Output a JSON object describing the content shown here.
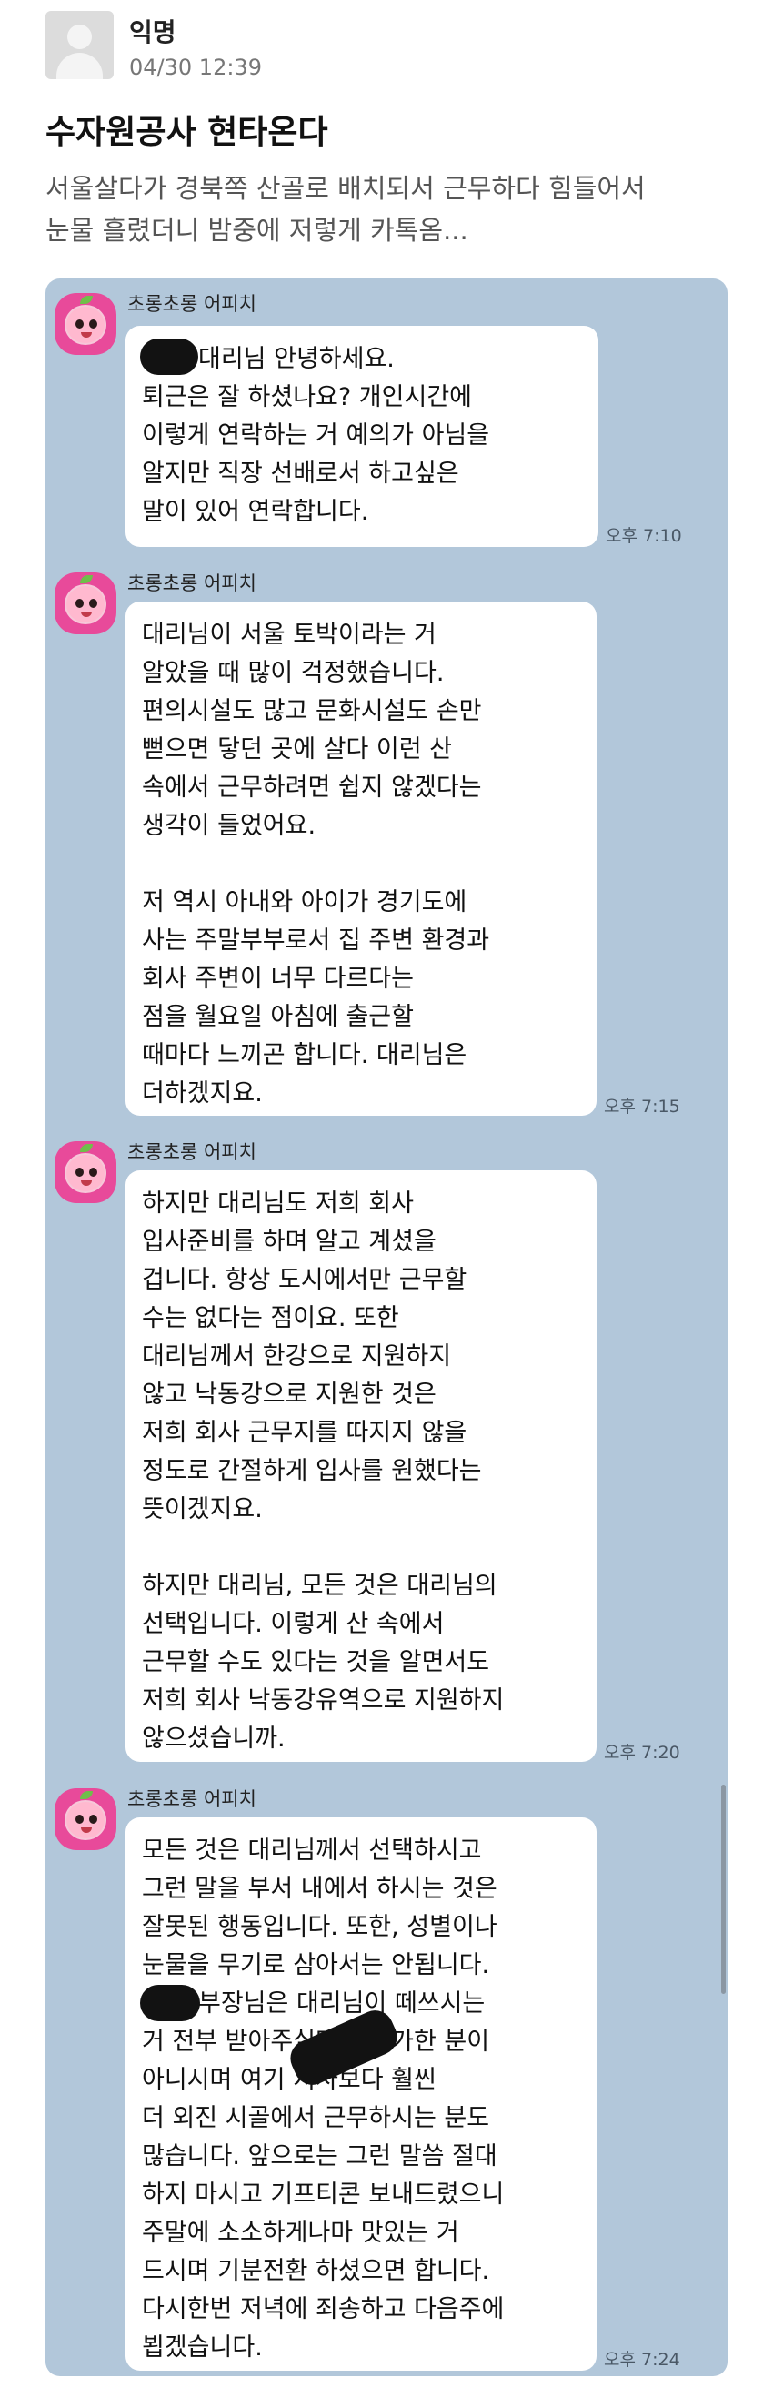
{
  "post": {
    "author": "익명",
    "date": "04/30 12:39",
    "title": "수자원공사 현타온다",
    "body_lines": [
      "서울살다가 경북쪽 산골로 배치되서 근무하다 힘들어서",
      "눈물 흘렸더니 밤중에 저렇게 카톡옴..."
    ]
  },
  "chat": {
    "sender": "초롱초롱 어피치",
    "messages": [
      {
        "lines": [
          "대리님 안녕하세요.",
          "퇴근은 잘 하셨나요? 개인시간에",
          "이렇게 연락하는 거 예의가 아님을",
          "알지만 직장 선배로서 하고싶은",
          "말이 있어 연락합니다."
        ],
        "time": "오후 7:10"
      },
      {
        "lines": [
          "대리님이 서울 토박이라는 거",
          "알았을 때 많이 걱정했습니다.",
          "편의시설도 많고 문화시설도 손만",
          "뻗으면 닿던 곳에 살다 이런 산",
          "속에서 근무하려면 쉽지 않겠다는",
          "생각이 들었어요.",
          "",
          "저 역시 아내와 아이가 경기도에",
          "사는 주말부부로서 집 주변 환경과",
          "회사 주변이 너무 다르다는",
          "점을 월요일 아침에 출근할",
          "때마다 느끼곤 합니다. 대리님은",
          "더하겠지요."
        ],
        "time": "오후 7:15"
      },
      {
        "lines": [
          "하지만 대리님도 저희 회사",
          "입사준비를 하며 알고 계셨을",
          "겁니다. 항상 도시에서만 근무할",
          "수는 없다는 점이요. 또한",
          "대리님께서 한강으로 지원하지",
          "않고 낙동강으로 지원한 것은",
          "저희 회사 근무지를 따지지 않을",
          "정도로 간절하게 입사를 원했다는",
          "뜻이겠지요.",
          "",
          "하지만 대리님, 모든 것은 대리님의",
          "선택입니다. 이렇게 산 속에서",
          "근무할 수도 있다는 것을 알면서도",
          "저희 회사 낙동강유역으로 지원하지",
          "않으셨습니까."
        ],
        "time": "오후 7:20"
      },
      {
        "lines": [
          "모든 것은 대리님께서 선택하시고",
          "그런 말을 부서 내에서 하시는 것은",
          "잘못된 행동입니다. 또한, 성별이나",
          "눈물을 무기로 삼아서는 안됩니다.",
          "부장님은 대리님이 떼쓰시는",
          "거 전부 받아주실만큼 한가한 분이",
          "아니시며 여기 지사보다 훨씬",
          "더 외진 시골에서 근무하시는 분도",
          "많습니다. 앞으로는 그런 말씀 절대",
          "하지 마시고 기프티콘 보내드렸으니",
          "주말에 소소하게나마 맛있는 거",
          "드시며 기분전환 하셨으면 합니다.",
          "다시한번 저녁에 죄송하고 다음주에",
          "뵙겠습니다."
        ],
        "time": "오후 7:24"
      }
    ]
  }
}
